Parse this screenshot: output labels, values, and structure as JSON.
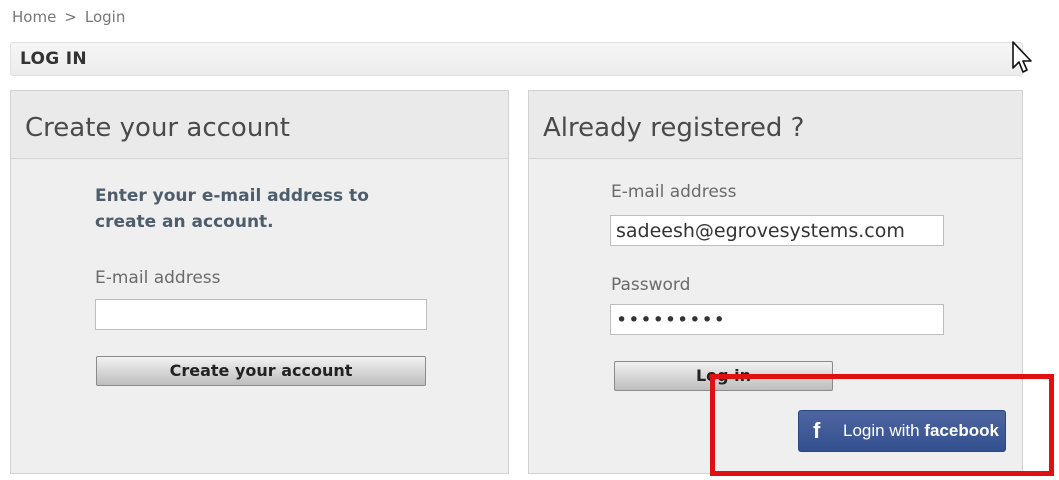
{
  "breadcrumb": {
    "home": "Home",
    "separator": ">",
    "current": "Login"
  },
  "page_title": "LOG IN",
  "create": {
    "heading": "Create your account",
    "intro_line1": "Enter your e-mail address to",
    "intro_line2": "create an account.",
    "email_label": "E-mail address",
    "email_value": "",
    "button": "Create your account"
  },
  "login": {
    "heading": "Already registered ?",
    "email_label": "E-mail address",
    "email_value": "sadeesh@egrovesystems.com",
    "password_label": "Password",
    "password_value": "•••••••••",
    "button": "Log in",
    "facebook_prefix": "Login with",
    "facebook_brand": "facebook",
    "facebook_icon": "f"
  },
  "colors": {
    "highlight": "#e01010",
    "facebook": "#3b5998"
  },
  "icons": [
    "facebook-icon",
    "mouse-pointer-icon"
  ]
}
